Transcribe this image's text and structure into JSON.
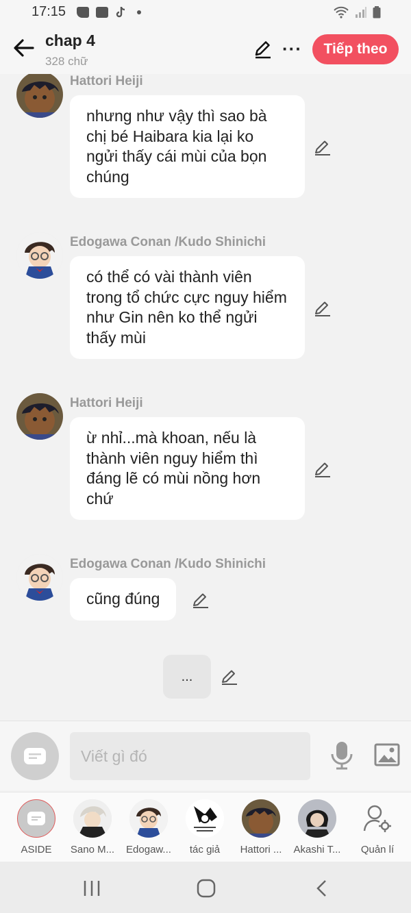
{
  "status": {
    "time": "17:15"
  },
  "header": {
    "title": "chap 4",
    "subtitle": "328 chữ",
    "next_label": "Tiếp theo"
  },
  "messages": [
    {
      "sender": "Hattori Heiji",
      "text": "nhưng như vậy thì sao bà chị bé Haibara kia lại ko ngửi thấy cái mùi của bọn chúng"
    },
    {
      "sender": "Edogawa Conan /Kudo Shinichi",
      "text": "có thể có vài thành viên trong tổ chức cực nguy hiểm như Gin nên ko thể ngửi thấy mùi"
    },
    {
      "sender": "Hattori Heiji",
      "text": "ừ nhỉ...mà khoan, nếu là thành viên nguy hiểm thì đáng lẽ có mùi nồng hơn chứ"
    },
    {
      "sender": "Edogawa Conan /Kudo Shinichi",
      "text": "cũng đúng"
    }
  ],
  "typing": {
    "text": "..."
  },
  "composer": {
    "placeholder": "Viết gì đó"
  },
  "characters": [
    {
      "name": "ASIDE"
    },
    {
      "name": "Sano M..."
    },
    {
      "name": "Edogaw..."
    },
    {
      "name": "tác giả"
    },
    {
      "name": "Hattori ..."
    },
    {
      "name": "Akashi T..."
    },
    {
      "name": "Quản lí"
    }
  ],
  "colors": {
    "accent": "#f25060",
    "background": "#f2f2f2",
    "bubble": "#ffffff"
  }
}
